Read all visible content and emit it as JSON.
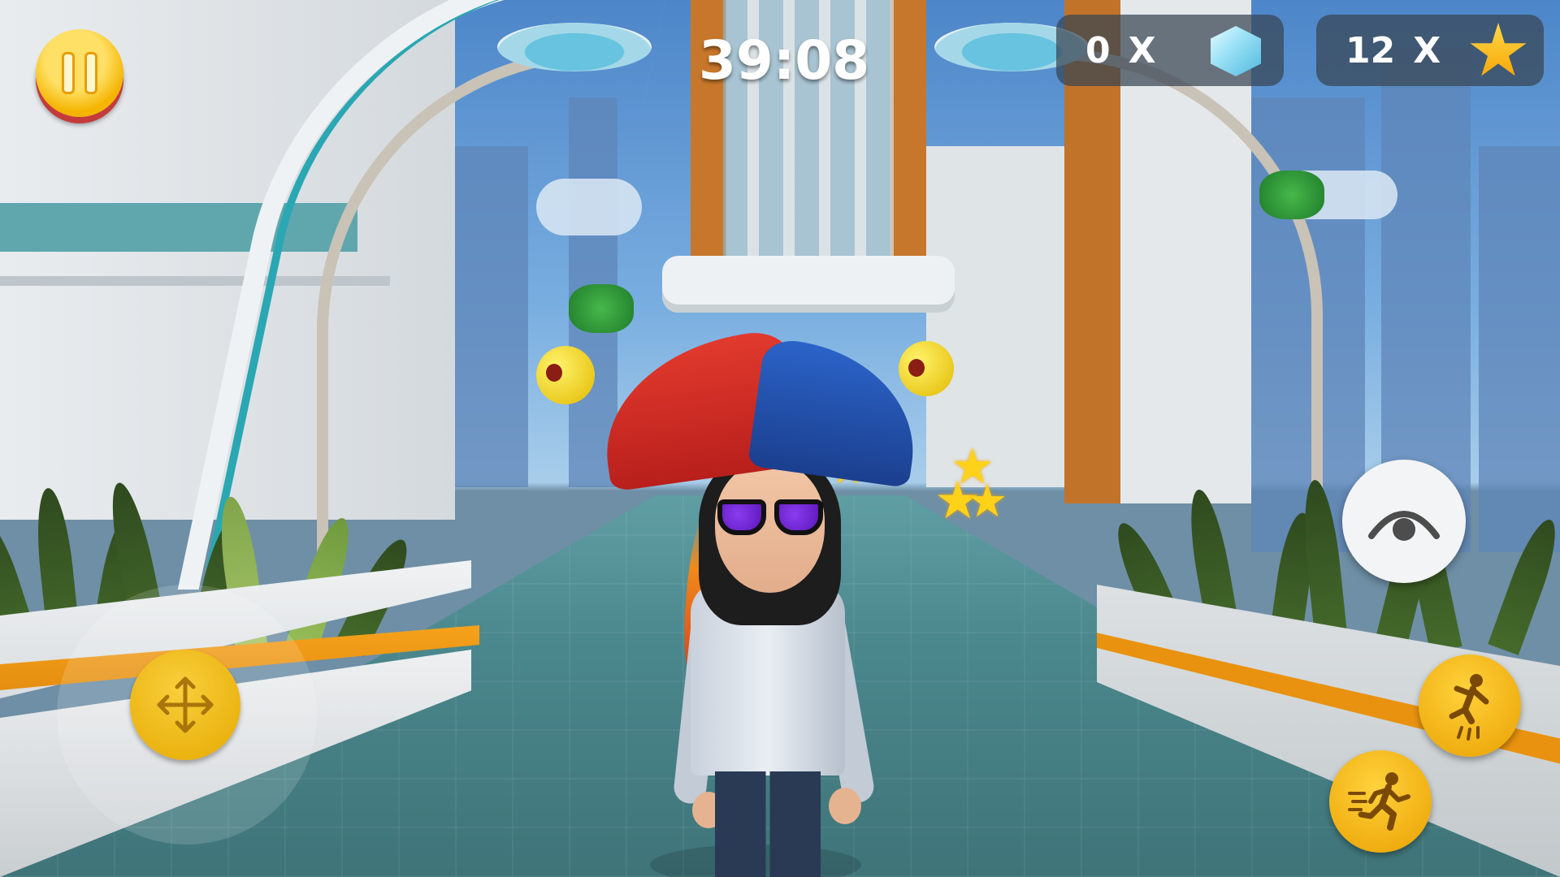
{
  "hud": {
    "timer": "39:08",
    "gems": {
      "count": "0",
      "multiplier": "X",
      "icon": "gem-icon",
      "color": "#8fdcf2"
    },
    "stars": {
      "count": "12",
      "multiplier": "X",
      "icon": "star-icon",
      "color": "#ffc21a"
    }
  },
  "controls": {
    "pause": {
      "icon": "pause-icon",
      "color": "#f4b400"
    },
    "joystick": {
      "icon": "move-arrows-icon",
      "color": "#f2c01d"
    },
    "camera": {
      "icon": "eye-icon",
      "color": "#f3f4f5"
    },
    "jump": {
      "icon": "jump-icon",
      "color": "#f2b400"
    },
    "run": {
      "icon": "run-icon",
      "color": "#f2b400"
    }
  }
}
